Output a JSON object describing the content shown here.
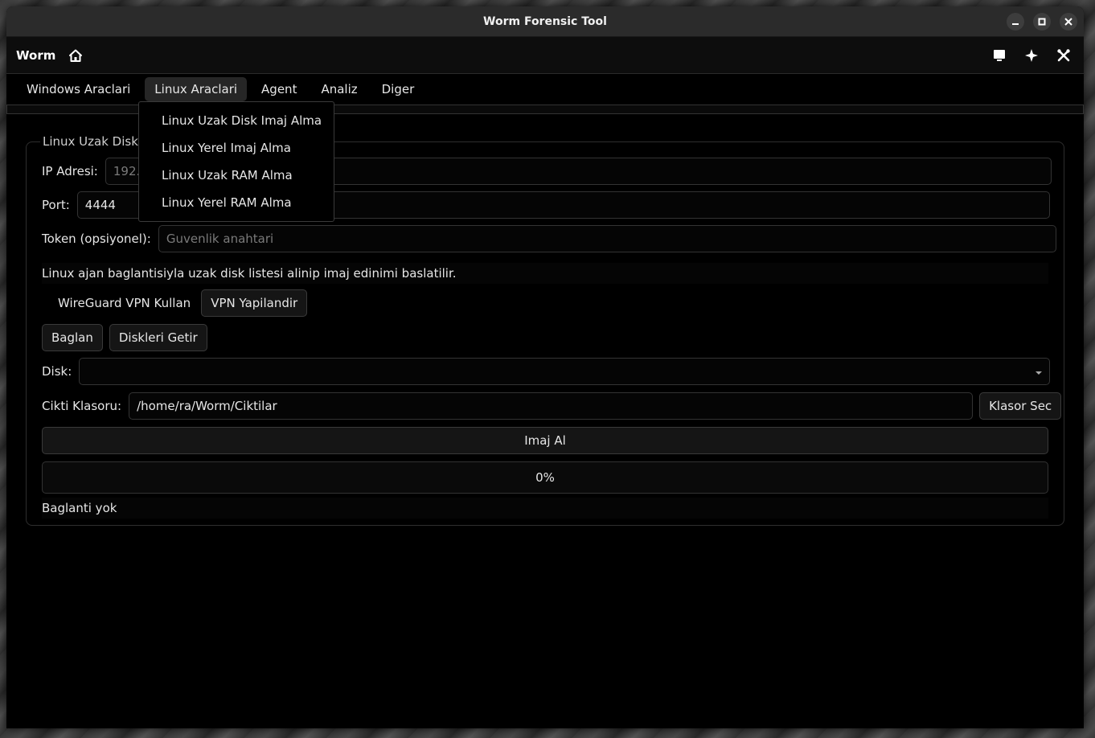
{
  "window": {
    "title": "Worm Forensic Tool"
  },
  "header": {
    "app_name": "Worm"
  },
  "menubar": {
    "items": [
      "Windows Araclari",
      "Linux Araclari",
      "Agent",
      "Analiz",
      "Diger"
    ],
    "active_index": 1
  },
  "dropdown": {
    "items": [
      "Linux Uzak Disk Imaj Alma",
      "Linux Yerel Imaj Alma",
      "Linux Uzak RAM Alma",
      "Linux Yerel RAM Alma"
    ]
  },
  "group": {
    "title": "Linux Uzak Disk Imaj Alma"
  },
  "form": {
    "ip_label": "IP Adresi:",
    "ip_placeholder": "192.168.1.100",
    "port_label": "Port:",
    "port_value": "4444",
    "token_label": "Token (opsiyonel):",
    "token_placeholder": "Guvenlik anahtari",
    "info_text": "Linux ajan baglantisiyla uzak disk listesi alinip imaj edinimi baslatilir.",
    "wireguard_label": "WireGuard VPN Kullan",
    "vpn_config_button": "VPN Yapilandir",
    "connect_button": "Baglan",
    "get_disks_button": "Diskleri Getir",
    "disk_label": "Disk:",
    "disk_value": "",
    "output_label": "Cikti Klasoru:",
    "output_value": "/home/ra/Worm/Ciktilar",
    "choose_folder_button": "Klasor Sec",
    "image_button": "Imaj Al",
    "progress_text": "0%",
    "progress_value": 0,
    "status_text": "Baglanti yok"
  },
  "icons": {
    "home": "home-icon",
    "monitor": "monitor-icon",
    "sparkle": "sparkle-icon",
    "tools": "tools-icon",
    "minimize": "minimize-icon",
    "maximize": "maximize-icon",
    "close": "close-icon"
  }
}
